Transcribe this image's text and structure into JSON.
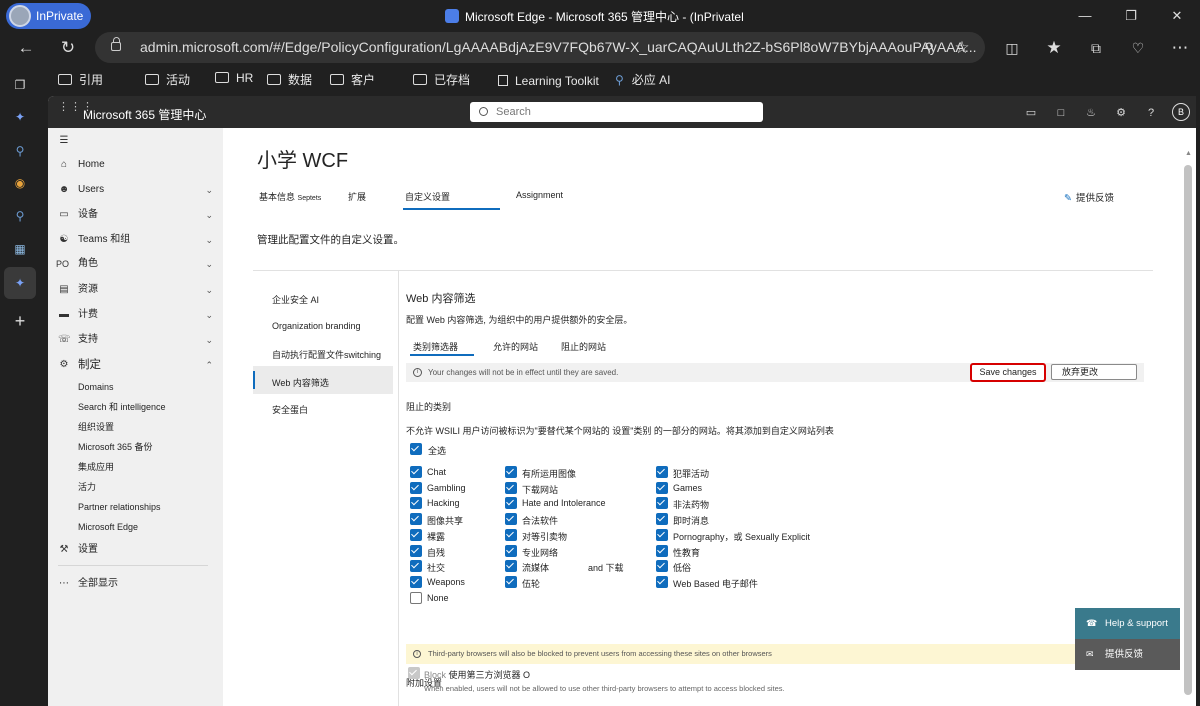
{
  "browser": {
    "inprivate_label": "InPrivate",
    "window_title": "Microsoft Edge - Microsoft 365 管理中心 - (InPrivatel",
    "url": "admin.microsoft.com/#/Edge/PolicyConfiguration/LgAAAABdjAzE9V7FQb67W-X_uarCAQAuULth2Z-bS6Pl8oW7BYbjAAAouPAyAAA...",
    "favorites": [
      "引用",
      "活动",
      "HR",
      "数据",
      "客户",
      "已存档",
      "Learning Toolkit",
      "必应 AI"
    ]
  },
  "m365": {
    "app_title": "Microsoft 365 管理中心",
    "search_placeholder": "Search",
    "avatar_initial": "B"
  },
  "sidebar": {
    "items": [
      {
        "label": "Home",
        "icon": "home-icon"
      },
      {
        "label": "Users",
        "icon": "person-icon"
      },
      {
        "label": "设备",
        "icon": "device-icon"
      },
      {
        "label": "Teams 和组",
        "icon": "teams-icon"
      },
      {
        "label": "角色",
        "icon": "roles-icon"
      },
      {
        "label": "资源",
        "icon": "resources-icon"
      },
      {
        "label": "计费",
        "icon": "billing-icon"
      },
      {
        "label": "支持",
        "icon": "support-icon"
      },
      {
        "label": "制定",
        "icon": "gear-icon"
      }
    ],
    "sub_items": [
      "Domains",
      "Search 和 intelligence",
      "组织设置",
      "Microsoft 365 备份",
      "集成应用",
      "活力",
      "Partner relationships",
      "Microsoft Edge"
    ],
    "settings_label": "设置",
    "show_all_label": "全部显示",
    "roles_prefix": "PO"
  },
  "page": {
    "title": "小学 WCF",
    "tabs": [
      "基本信息",
      "Septets",
      "扩展",
      "自定义设置",
      "Assignment"
    ],
    "feedback_label": "提供反馈",
    "description": "管理此配置文件的自定义设置。"
  },
  "left_nav": {
    "items": [
      "企业安全 AI",
      "Organization branding",
      "自动执行配置文件switching",
      "Web 内容筛选",
      "安全蛋白"
    ],
    "selected": "Web 内容筛选"
  },
  "filter": {
    "title": "Web 内容筛选",
    "description": "配置 Web 内容筛选, 为组织中的用户提供额外的安全层。",
    "subtabs": [
      "类别筛选器",
      "允许的网站",
      "阻止的网站"
    ],
    "notice": "Your changes will not be in effect until they are saved.",
    "save_label": "Save changes",
    "discard_label": "放弃更改",
    "blocked_heading": "阻止的类别",
    "blocked_desc": "不允许 WSILI 用户访问被标识为\"要替代某个网站的 设置\"类别 的一部分的网站。将其添加到自定义网站列表",
    "all_label": "全选",
    "col1": [
      "Chat",
      "Gambling",
      "Hacking",
      "图像共享",
      "裸露",
      "自残",
      "社交",
      "Weapons",
      "None"
    ],
    "col2": [
      "有所运用图像",
      "下载网站",
      "Hate and Intolerance",
      "合法软件",
      "对等引卖物",
      "专业网络",
      "流媒体",
      "伍轮"
    ],
    "col2_extra": "and 下载",
    "col3": [
      "犯罪活动",
      "Games",
      "非法药物",
      "即时消息",
      "Pornography，或 Sexually Explicit",
      "性教育",
      "低俗",
      "Web Based 电子邮件"
    ],
    "warning": "Third-party browsers will also be blocked to prevent users from accessing these sites on other browsers",
    "additional_heading": "附加设置",
    "block_label": "Block",
    "block_desc": "使用第三方浏览器 O",
    "block_hint": "When enabled, users will not be allowed to use other third-party browsers to attempt to access blocked sites."
  },
  "help": {
    "support_label": "Help & support",
    "feedback_label": "提供反馈"
  },
  "colors": {
    "accent": "#0f6cbd",
    "save_outline": "#d60000",
    "inprivate": "#3a6ad6"
  }
}
